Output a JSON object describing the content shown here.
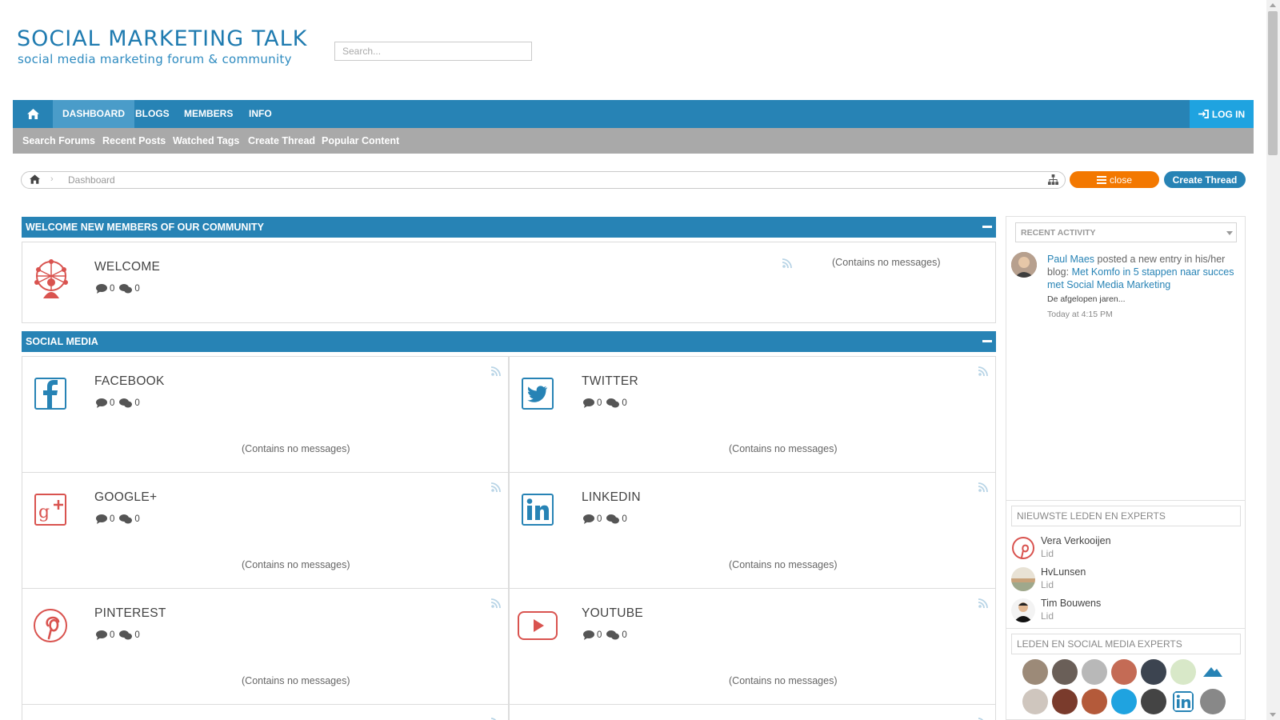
{
  "header": {
    "site_title": "SOCIAL MARKETING TALK",
    "site_subtitle": "social media marketing forum & community",
    "search_placeholder": "Search..."
  },
  "nav": {
    "home_icon": "home-icon",
    "items": [
      "DASHBOARD",
      "BLOGS",
      "MEMBERS",
      "INFO"
    ],
    "active": "DASHBOARD",
    "login_label": "LOG IN",
    "login_icon": "sign-in-icon"
  },
  "subnav": {
    "items": [
      "Search Forums",
      "Recent Posts",
      "Watched Tags",
      "Create Thread",
      "Popular Content"
    ]
  },
  "breadcrumb": {
    "current": "Dashboard",
    "close_label": "close",
    "create_thread_label": "Create Thread"
  },
  "colors": {
    "primary": "#2783b5",
    "subnav": "#a9a9a9",
    "close_button": "#f37800",
    "login_button": "#1fa3e0"
  },
  "sections": [
    {
      "title": "WELCOME NEW MEMBERS OF OUR COMMUNITY",
      "forums": [
        {
          "name": "WELCOME",
          "threads": "0",
          "messages": "0",
          "status": "(Contains no messages)",
          "icon": "network-people-icon"
        }
      ]
    },
    {
      "title": "SOCIAL MEDIA",
      "forums": [
        {
          "name": "FACEBOOK",
          "threads": "0",
          "messages": "0",
          "status": "(Contains no messages)",
          "icon": "facebook-icon"
        },
        {
          "name": "TWITTER",
          "threads": "0",
          "messages": "0",
          "status": "(Contains no messages)",
          "icon": "twitter-icon"
        },
        {
          "name": "GOOGLE+",
          "threads": "0",
          "messages": "0",
          "status": "(Contains no messages)",
          "icon": "google-plus-icon"
        },
        {
          "name": "LINKEDIN",
          "threads": "0",
          "messages": "0",
          "status": "(Contains no messages)",
          "icon": "linkedin-icon"
        },
        {
          "name": "PINTEREST",
          "threads": "0",
          "messages": "0",
          "status": "(Contains no messages)",
          "icon": "pinterest-icon"
        },
        {
          "name": "YOUTUBE",
          "threads": "0",
          "messages": "0",
          "status": "(Contains no messages)",
          "icon": "youtube-icon"
        }
      ]
    }
  ],
  "sidebar": {
    "activity_select": "RECENT ACTIVITY",
    "activity": {
      "user": "Paul Maes",
      "action": " posted a new entry in his/her blog: ",
      "entry": "Met Komfo in 5 stappen naar succes met Social Media Marketing",
      "snippet": "De afgelopen jaren...",
      "time": "Today at 4:15 PM"
    },
    "newest_title": "NIEUWSTE LEDEN EN EXPERTS",
    "newest_members": [
      {
        "name": "Vera Verkooijen",
        "role": "Lid"
      },
      {
        "name": "HvLunsen",
        "role": "Lid"
      },
      {
        "name": "Tim Bouwens",
        "role": "Lid"
      }
    ],
    "experts_title": "LEDEN EN SOCIAL MEDIA EXPERTS"
  }
}
